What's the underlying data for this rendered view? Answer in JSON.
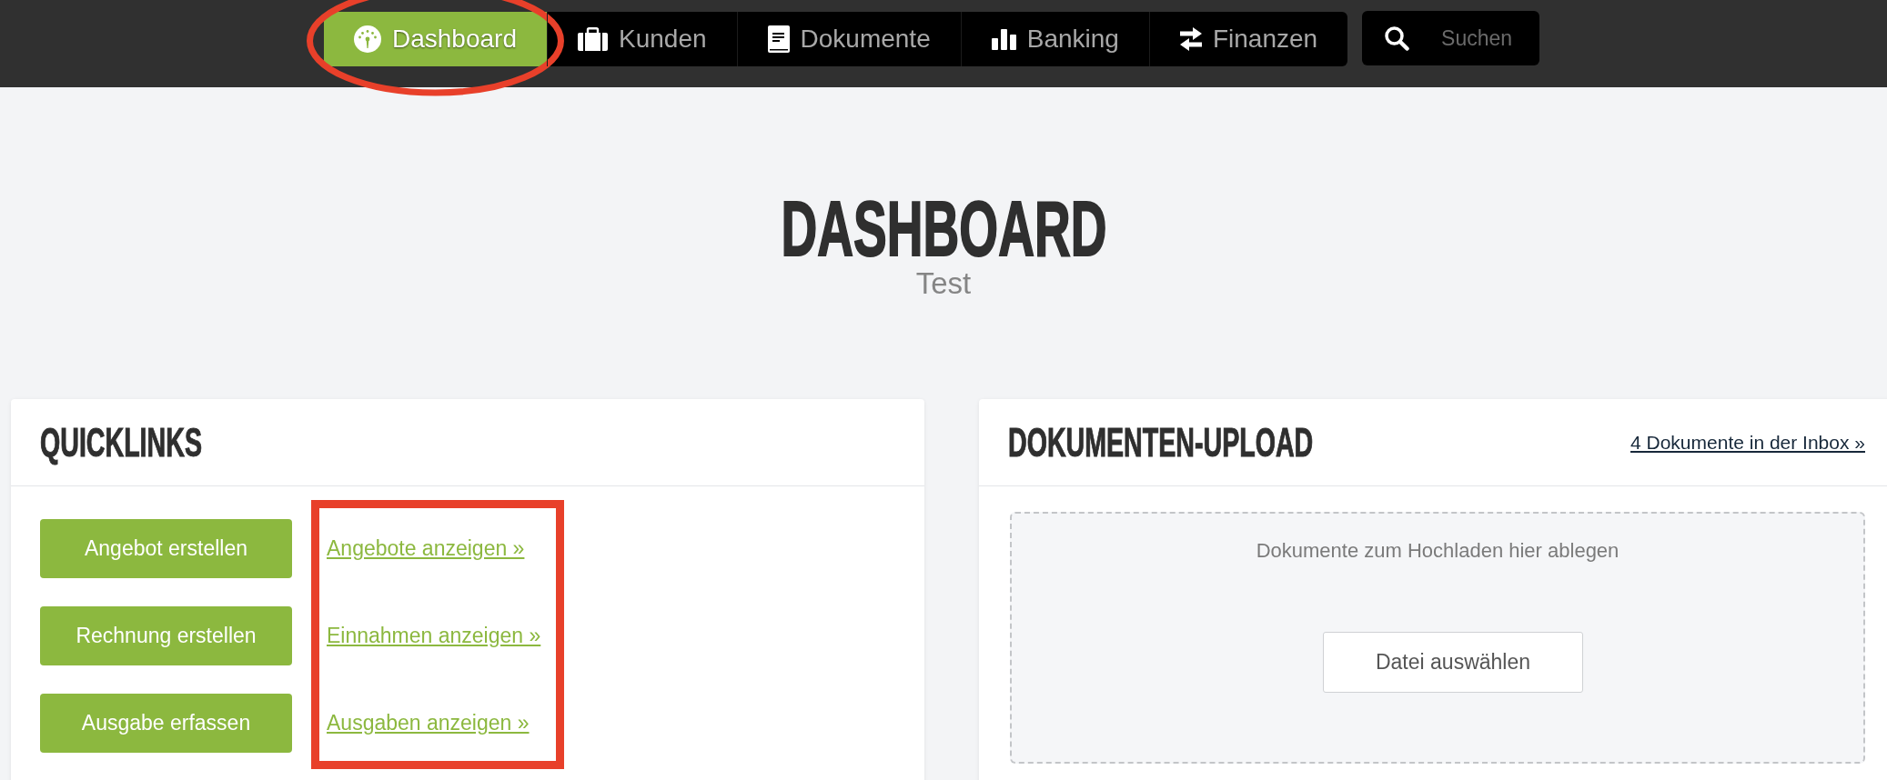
{
  "nav": {
    "tabs": [
      {
        "label": "Dashboard",
        "selected": true,
        "circled": true
      },
      {
        "label": "Kunden",
        "selected": false,
        "circled": false
      },
      {
        "label": "Dokumente",
        "selected": false,
        "circled": false
      },
      {
        "label": "Banking",
        "selected": false,
        "circled": false
      },
      {
        "label": "Finanzen",
        "selected": false,
        "circled": false
      }
    ],
    "search": {
      "placeholder": "Suchen"
    }
  },
  "header": {
    "title": "DASHBOARD",
    "subtitle": "Test"
  },
  "quicklinks": {
    "title": "QUICKLINKS",
    "buttons": [
      "Angebot erstellen",
      "Rechnung erstellen",
      "Ausgabe erfassen"
    ],
    "links": [
      "Angebote anzeigen »",
      "Einnahmen anzeigen »",
      "Ausgaben anzeigen »"
    ],
    "links_framed": true
  },
  "upload": {
    "title": "DOKUMENTEN-UPLOAD",
    "inbox_link": "4 Dokumente in der Inbox »",
    "drop_hint": "Dokumente zum Hochladen hier ablegen",
    "button": "Datei auswählen"
  }
}
